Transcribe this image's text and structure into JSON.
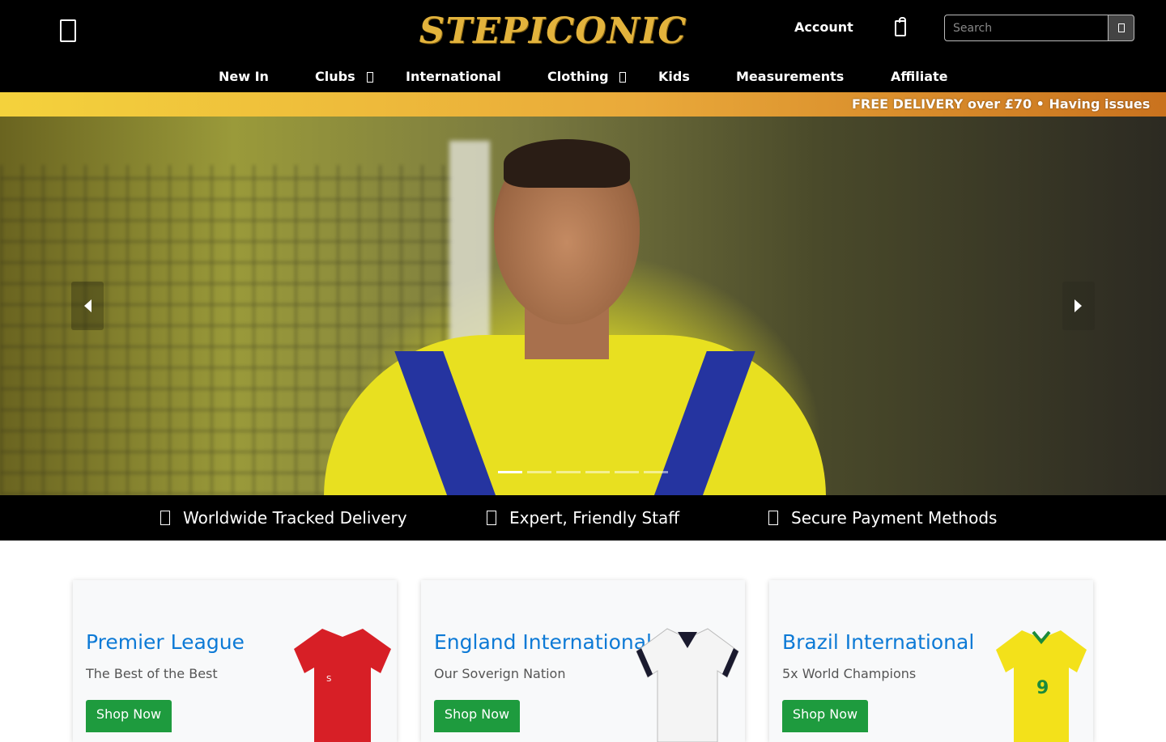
{
  "header": {
    "logo_text": "STEPICONIC",
    "account_label": "Account",
    "search_placeholder": "Search",
    "icons": {
      "menu": "hamburger-icon",
      "bag": "shopping-bag-icon",
      "search": "search-icon"
    }
  },
  "nav": {
    "items": [
      {
        "label": "New In",
        "has_dropdown": false
      },
      {
        "label": "Clubs",
        "has_dropdown": true
      },
      {
        "label": "International",
        "has_dropdown": false
      },
      {
        "label": "Clothing",
        "has_dropdown": true
      },
      {
        "label": "Kids",
        "has_dropdown": false
      },
      {
        "label": "Measurements",
        "has_dropdown": false
      },
      {
        "label": "Affiliate",
        "has_dropdown": false
      }
    ]
  },
  "promo": {
    "text": "FREE DELIVERY over £70  •  Having issues"
  },
  "hero": {
    "slide_count": 6,
    "active_slide": 1,
    "arrows": {
      "prev": "chevron-left-icon",
      "next": "chevron-right-icon"
    }
  },
  "features": [
    {
      "icon": "globe-icon",
      "text": "Worldwide Tracked Delivery"
    },
    {
      "icon": "user-icon",
      "text": "Expert, Friendly Staff"
    },
    {
      "icon": "lock-icon",
      "text": "Secure Payment Methods"
    }
  ],
  "cards": [
    {
      "title": "Premier League",
      "subtitle": "The Best of the Best",
      "button": "Shop Now",
      "shirt_color": "#d71f26"
    },
    {
      "title": "England International",
      "subtitle": "Our Soverign Nation",
      "button": "Shop Now",
      "shirt_color": "#f4f4f4"
    },
    {
      "title": "Brazil International",
      "subtitle": "5x World Champions",
      "button": "Shop Now",
      "shirt_color": "#f3e11a"
    }
  ],
  "colors": {
    "accent_link": "#0d7ad6",
    "button_green": "#1e9b3e",
    "promo_gold": "#e9a93a",
    "header_bg": "#000000"
  }
}
